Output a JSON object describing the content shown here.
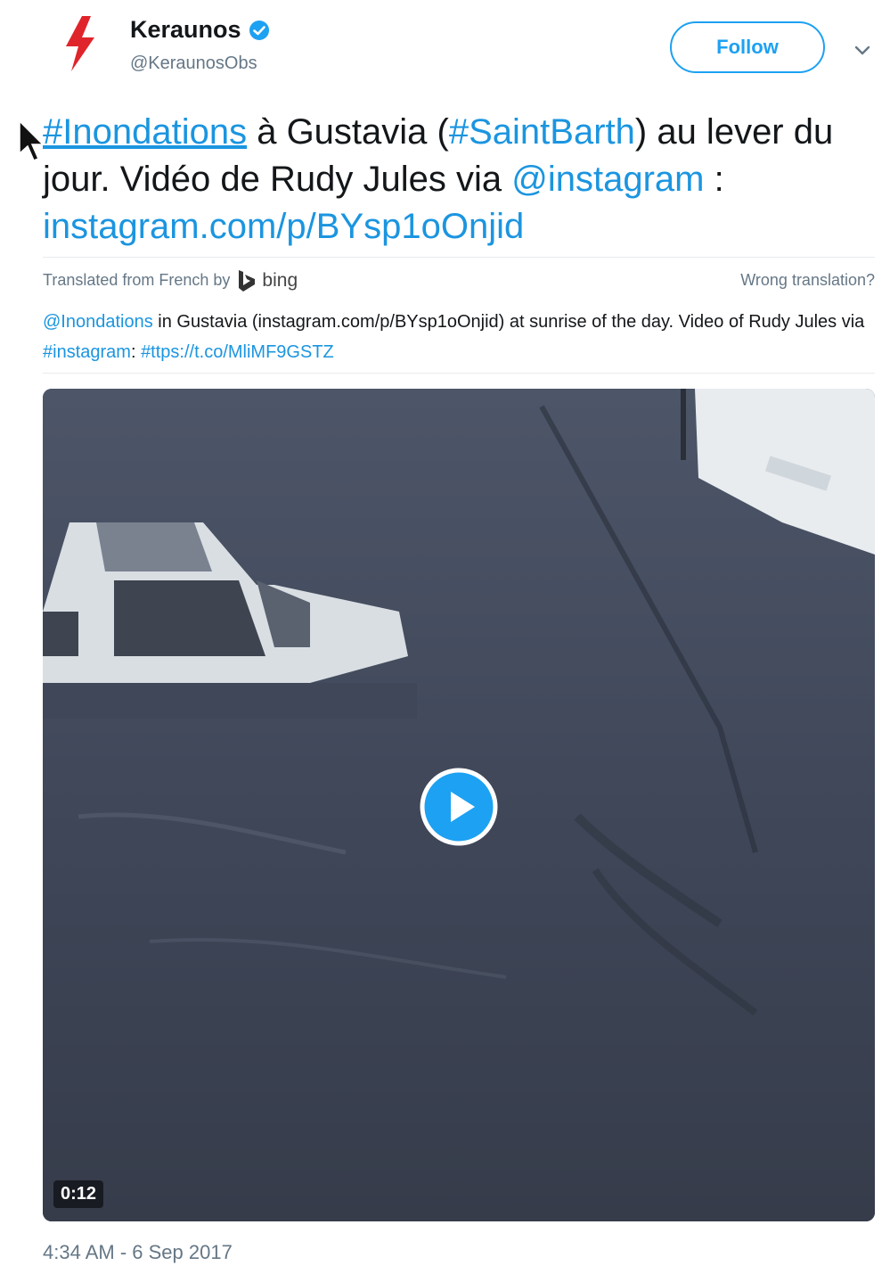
{
  "header": {
    "display_name": "Keraunos",
    "handle": "@KeraunosObs",
    "follow_label": "Follow",
    "verified_icon": "verified-badge-icon",
    "avatar_icon": "lightning-bolt-icon",
    "caret_icon": "chevron-down-icon"
  },
  "tweet": {
    "hashtag1": "#Inondations",
    "text1": " à Gustavia (",
    "hashtag2": "#SaintBarth",
    "text2": ") au lever du jour. Vidéo de Rudy Jules via ",
    "mention": "@instagram",
    "text3": " : ",
    "url": "instagram.com/p/BYsp1oOnjid"
  },
  "translation": {
    "translated_from": "Translated from French by",
    "provider": "bing",
    "wrong_label": "Wrong translation?",
    "mention": "@Inondations",
    "text1": " in Gustavia (instagram.com/p/BYsp1oOnjid) at sunrise of the day. Video of Rudy Jules via ",
    "hashtag": "#instagram",
    "text2": ": ",
    "link": "#ttps://t.co/MliMF9GSTZ"
  },
  "video": {
    "duration": "0:12",
    "play_icon": "play-icon"
  },
  "timestamp": "4:34 AM - 6 Sep 2017",
  "colors": {
    "accent": "#1da1f2",
    "link": "#1b95e0",
    "secondary_text": "#657786",
    "brand_red": "#e0242b"
  }
}
